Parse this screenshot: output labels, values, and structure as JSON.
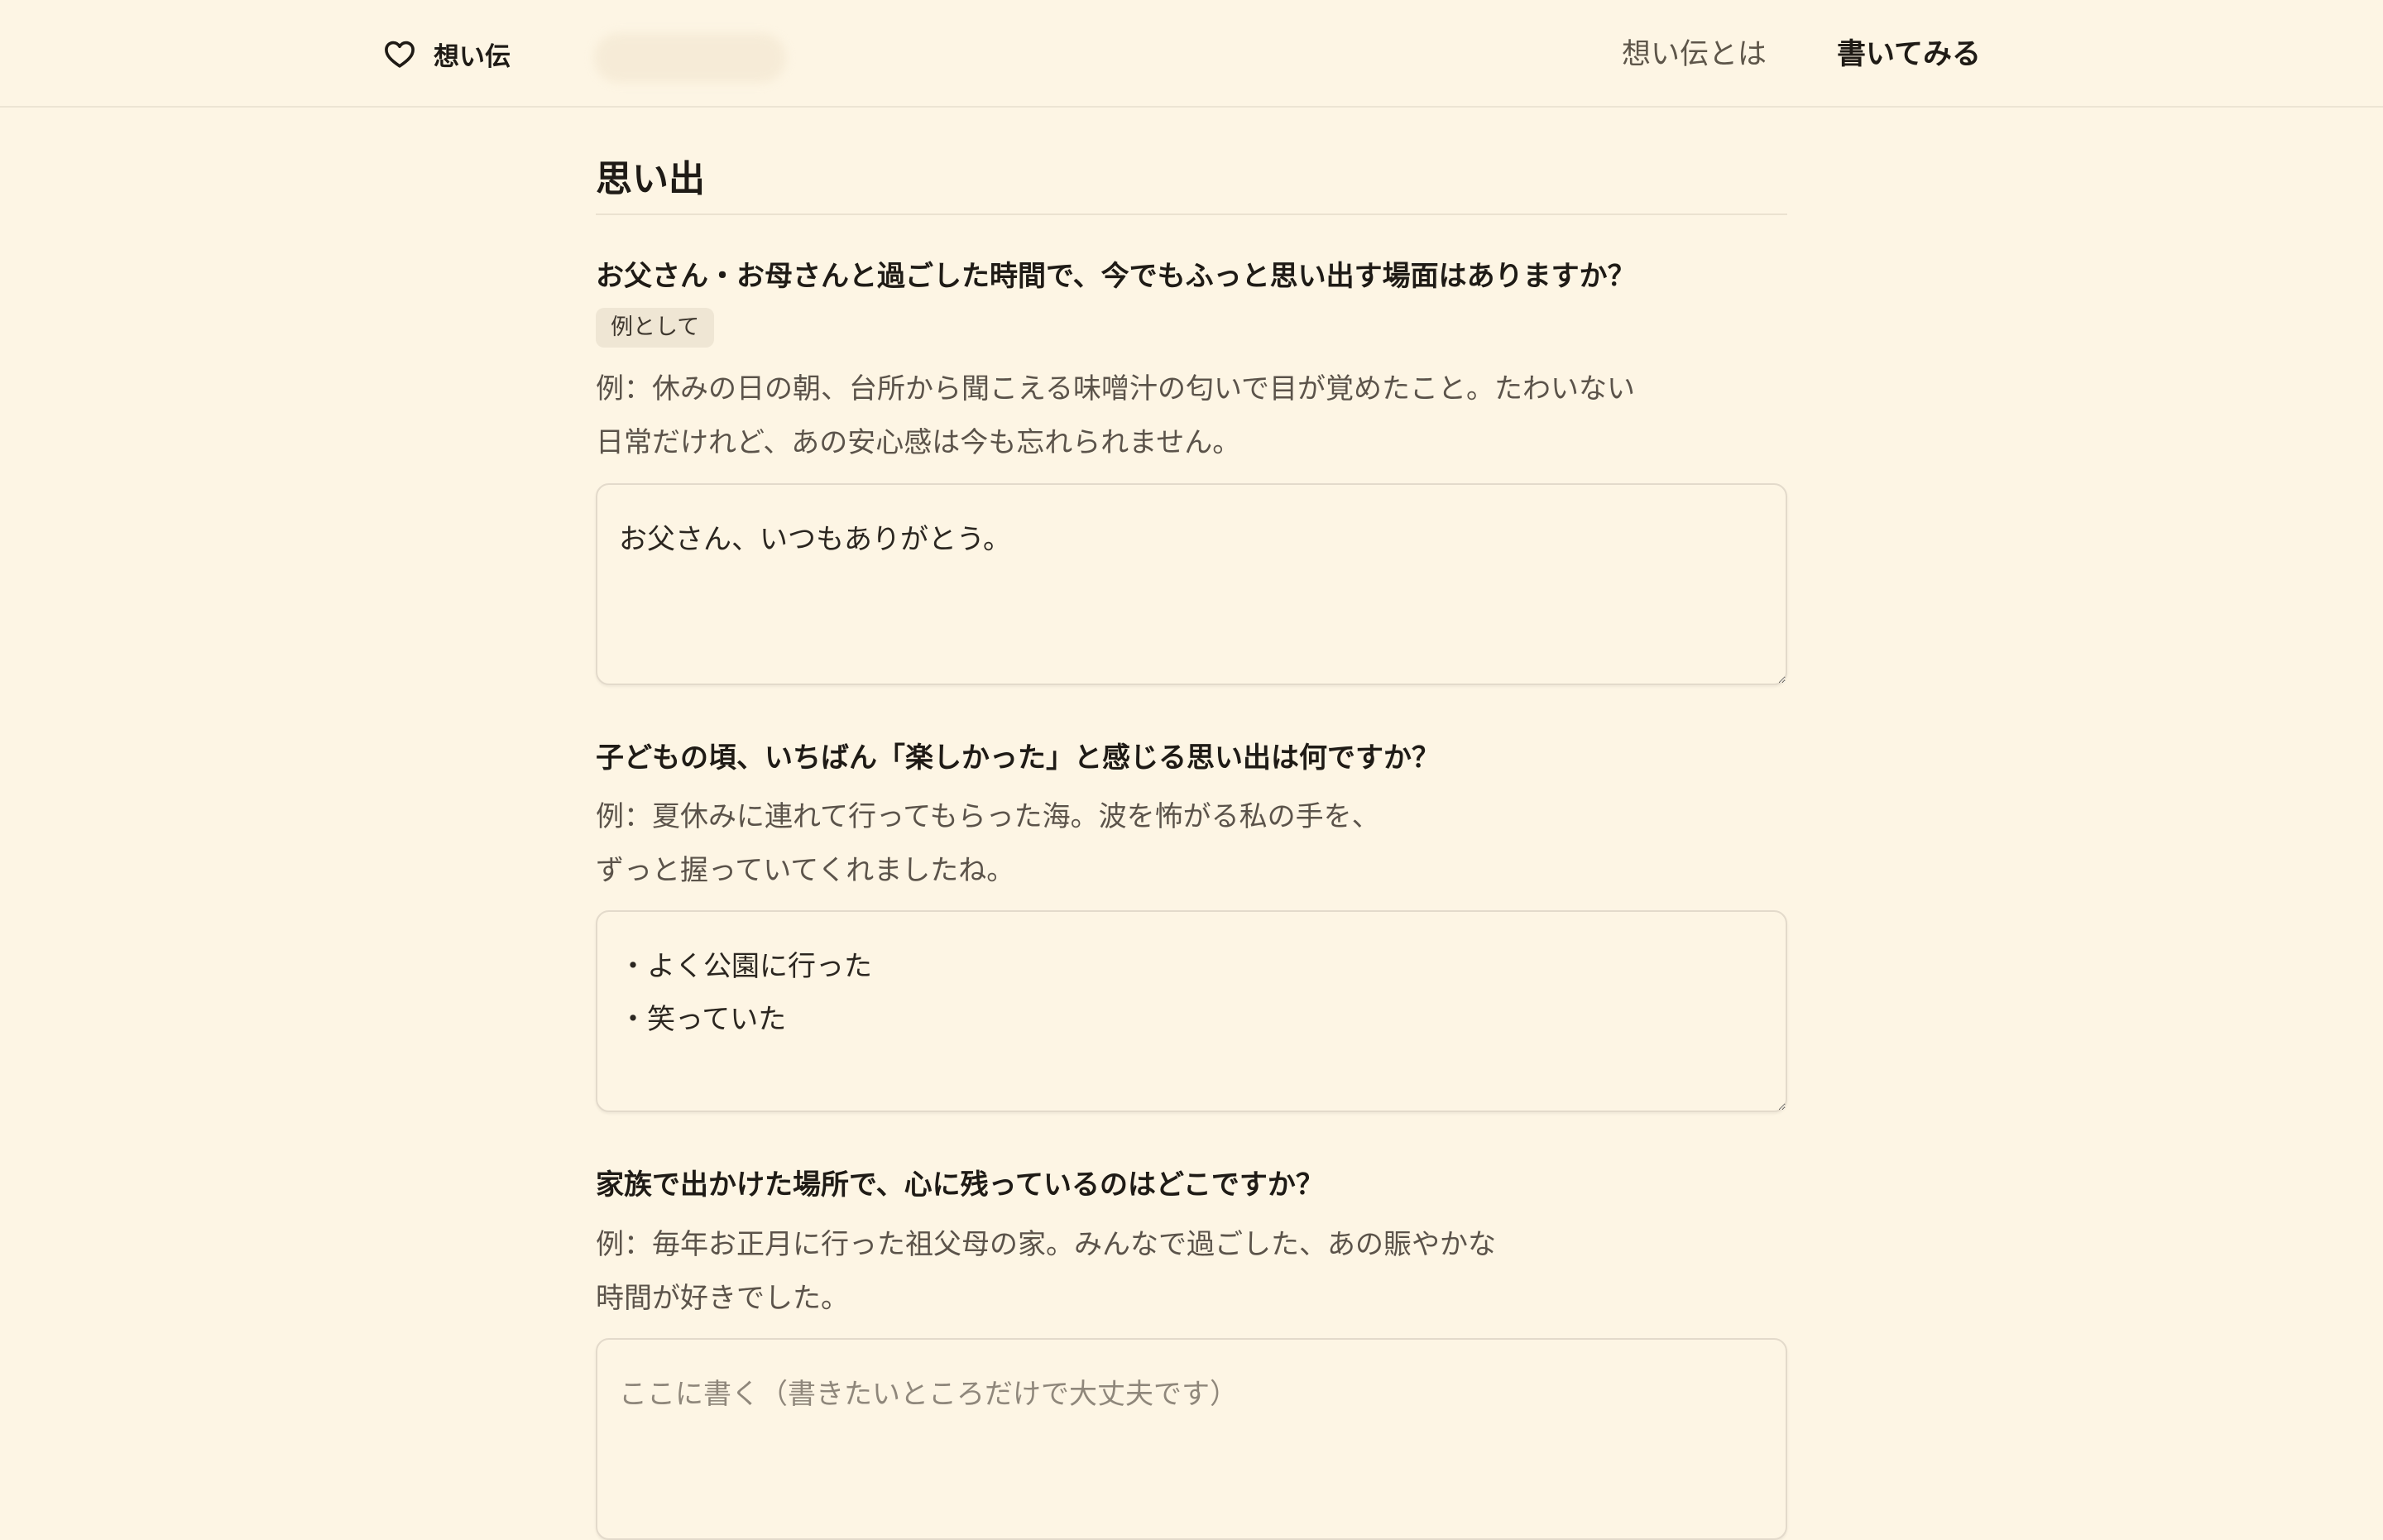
{
  "header": {
    "logo_text": "想い伝",
    "nav_about": "想い伝とは",
    "nav_write": "書いてみる"
  },
  "section": {
    "title": "思い出"
  },
  "questions": [
    {
      "text": "お父さん・お母さんと過ごした時間で、今でもふっと思い出す場面はありますか？",
      "badge": "例として",
      "example_line1": "例：休みの日の朝、台所から聞こえる味噌汁の匂いで目が覚めたこと。たわいない",
      "example_line2": "日常だけれど、あの安心感は今も忘れられません。",
      "answer": "お父さん、いつもありがとう。"
    },
    {
      "text": "子どもの頃、いちばん「楽しかった」と感じる思い出は何ですか？",
      "example_line1": "例：夏休みに連れて行ってもらった海。波を怖がる私の手を、",
      "example_line2": "ずっと握っていてくれましたね。",
      "answer": "・よく公園に行った\n・笑っていた"
    },
    {
      "text": "家族で出かけた場所で、心に残っているのはどこですか？",
      "example_line1": "例：毎年お正月に行った祖父母の家。みんなで過ごした、あの賑やかな",
      "example_line2": "時間が好きでした。",
      "answer": "",
      "placeholder": "ここに書く（書きたいところだけで大丈夫です）"
    }
  ],
  "icons": {
    "logo": "heart-outline-icon"
  }
}
